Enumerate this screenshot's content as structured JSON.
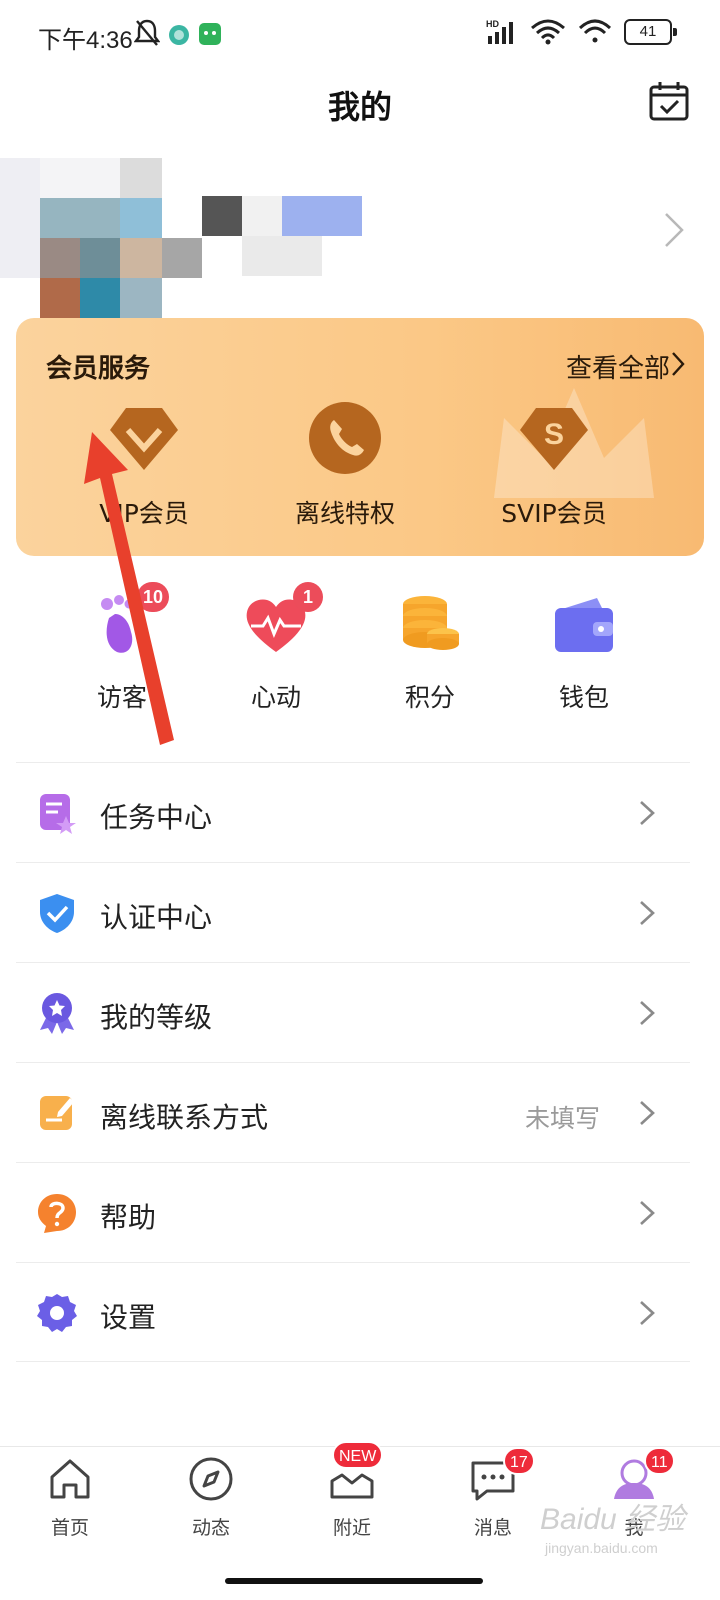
{
  "status_bar": {
    "time": "下午4:36",
    "battery": "41",
    "network": "HD"
  },
  "header": {
    "title": "我的"
  },
  "member_card": {
    "title": "会员服务",
    "view_all": "查看全部",
    "items": [
      {
        "label": "VIP会员",
        "icon": "vip-diamond-icon"
      },
      {
        "label": "离线特权",
        "icon": "phone-icon"
      },
      {
        "label": "SVIP会员",
        "icon": "svip-diamond-icon"
      }
    ]
  },
  "quick_entries": [
    {
      "label": "访客",
      "badge": "10",
      "icon": "footprint-icon"
    },
    {
      "label": "心动",
      "badge": "1",
      "icon": "heartbeat-icon"
    },
    {
      "label": "积分",
      "badge": "",
      "icon": "coins-icon"
    },
    {
      "label": "钱包",
      "badge": "",
      "icon": "wallet-icon"
    }
  ],
  "menu": [
    {
      "label": "任务中心",
      "value": "",
      "icon": "task-icon"
    },
    {
      "label": "认证中心",
      "value": "",
      "icon": "shield-check-icon"
    },
    {
      "label": "我的等级",
      "value": "",
      "icon": "medal-icon"
    },
    {
      "label": "离线联系方式",
      "value": "未填写",
      "icon": "edit-note-icon"
    },
    {
      "label": "帮助",
      "value": "",
      "icon": "help-icon"
    },
    {
      "label": "设置",
      "value": "",
      "icon": "gear-icon"
    }
  ],
  "tabbar": [
    {
      "label": "首页",
      "badge": "",
      "icon": "home-icon"
    },
    {
      "label": "动态",
      "badge": "",
      "icon": "compass-icon"
    },
    {
      "label": "附近",
      "badge": "NEW",
      "icon": "nearby-icon"
    },
    {
      "label": "消息",
      "badge": "17",
      "icon": "message-icon"
    },
    {
      "label": "我",
      "badge": "11",
      "icon": "profile-icon"
    }
  ],
  "watermark": {
    "text": "Baidu 经验",
    "sub": "jingyan.baidu.com"
  },
  "colors": {
    "member_card_start": "#fbd39d",
    "member_card_end": "#f8ba72",
    "member_icon": "#b5661f",
    "badge_red": "#ee2b3a",
    "annotation_arrow": "#e8402c",
    "active_tab": "#b07be0"
  }
}
